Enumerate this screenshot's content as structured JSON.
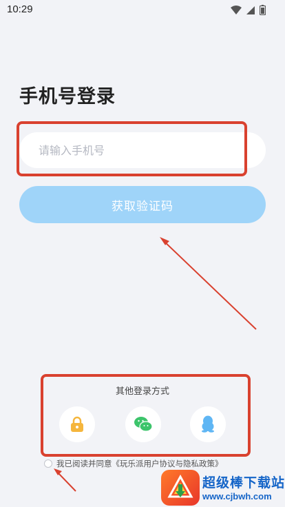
{
  "status_bar": {
    "time": "10:29",
    "icons": [
      "wifi-icon",
      "signal-icon",
      "battery-icon"
    ]
  },
  "login": {
    "title": "手机号登录",
    "phone_placeholder": "请输入手机号",
    "get_code_label": "获取验证码"
  },
  "other_login": {
    "label": "其他登录方式",
    "methods": [
      {
        "name": "password-login",
        "icon": "lock-icon",
        "color": "#f5b63d"
      },
      {
        "name": "wechat-login",
        "icon": "wechat-icon",
        "color": "#3cc46b"
      },
      {
        "name": "qq-login",
        "icon": "qq-icon",
        "color": "#5fb6f4"
      }
    ]
  },
  "agreement": {
    "text": "我已阅读并同意《玩乐派用户协议与隐私政策》"
  },
  "watermark": {
    "title": "超级棒下载站",
    "url": "www.cjbwh.com"
  },
  "colors": {
    "background": "#f2f3f7",
    "button": "#9fd4f9",
    "annotation": "#d9412f",
    "watermark": "#1565c8"
  }
}
